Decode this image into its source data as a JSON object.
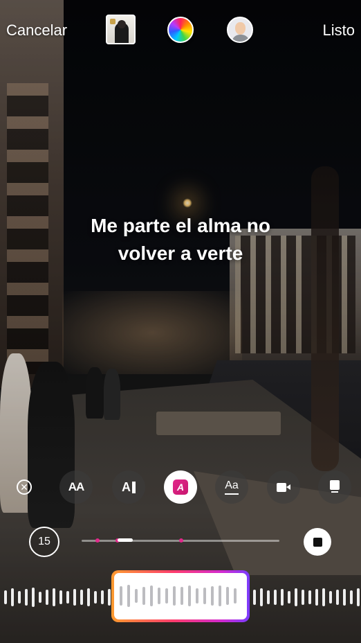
{
  "topbar": {
    "cancel_label": "Cancelar",
    "done_label": "Listo",
    "album_icon": "album-cover-icon",
    "color_icon": "color-wheel-icon",
    "avatar_icon": "avatar-icon"
  },
  "lyrics": {
    "line1": "Me parte el alma no",
    "line2": "volver a verte"
  },
  "toolbar": {
    "clear_glyph": "✕",
    "aa1_glyph": "AA",
    "ai_glyph": "A",
    "active_glyph": "A",
    "aa2_glyph": "Aa",
    "active_color": "#e2288b"
  },
  "playback": {
    "duration_label": "15"
  },
  "colors": {
    "accent_pink": "#e2288b",
    "selector_gradient": [
      "#ff9b2f",
      "#ff3c6d",
      "#d22ad0",
      "#7a3cff"
    ]
  }
}
